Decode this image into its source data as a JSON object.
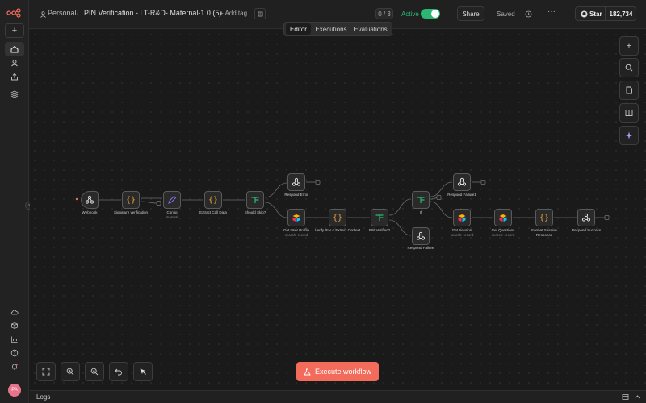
{
  "header": {
    "breadcrumb_owner": "Personal",
    "workflow_title": "PIN Verification - LT-R&D- Maternal-1.0 (5)",
    "add_tag": "+ Add tag",
    "counter": "0 / 3",
    "active_label": "Active",
    "share_label": "Share",
    "saved_label": "Saved",
    "star_label": "Star",
    "star_count": "182,734"
  },
  "tabs": [
    {
      "label": "Editor",
      "active": true
    },
    {
      "label": "Executions",
      "active": false
    },
    {
      "label": "Evaluations",
      "active": false
    }
  ],
  "nodes": [
    {
      "name": "Webhook",
      "sub": "",
      "icon": "webhook-icon"
    },
    {
      "name": "Signature verification",
      "sub": "",
      "icon": "code-icon"
    },
    {
      "name": "Config",
      "sub": "manual",
      "icon": "edit-icon"
    },
    {
      "name": "Extract Call Data",
      "sub": "",
      "icon": "code-icon"
    },
    {
      "name": "Should Skip?",
      "sub": "",
      "icon": "if-icon"
    },
    {
      "name": "Respond Error",
      "sub": "",
      "icon": "webhook-icon"
    },
    {
      "name": "Get User Profile",
      "sub": "search: record",
      "icon": "airtable-icon"
    },
    {
      "name": "Verify PIN & Extract Context",
      "sub": "",
      "icon": "code-icon"
    },
    {
      "name": "PIN Verified?",
      "sub": "",
      "icon": "if-icon"
    },
    {
      "name": "If",
      "sub": "",
      "icon": "if-icon"
    },
    {
      "name": "Respond Failure",
      "sub": "",
      "icon": "webhook-icon"
    },
    {
      "name": "Respond Failure1",
      "sub": "",
      "icon": "webhook-icon"
    },
    {
      "name": "Get Session",
      "sub": "search: record",
      "icon": "airtable-icon"
    },
    {
      "name": "Get Questions",
      "sub": "search: record",
      "icon": "airtable-icon"
    },
    {
      "name": "Format Session Response",
      "sub": "",
      "icon": "code-icon"
    },
    {
      "name": "Respond Success",
      "sub": "",
      "icon": "webhook-icon"
    }
  ],
  "execute_label": "Execute workflow",
  "logs_label": "Logs",
  "avatar_initials": "PA",
  "colors": {
    "accent": "#f26b5b",
    "active_toggle": "#2bb673",
    "code_icon": "#e8a33d",
    "if_icon": "#2bb673",
    "config_icon": "#8b6cf0"
  }
}
